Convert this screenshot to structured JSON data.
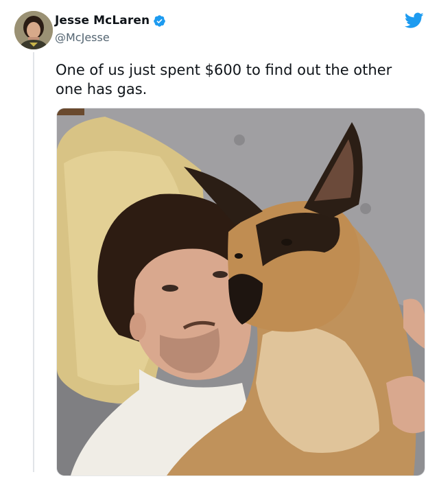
{
  "tweet": {
    "author": {
      "display_name": "Jesse McLaren",
      "handle": "@McJesse",
      "verified": true,
      "verified_icon": "verified-badge-icon",
      "avatar_icon": "avatar"
    },
    "platform_icon": "twitter-bird-icon",
    "text": "One of us just spent $600 to find out the other one has gas.",
    "media": {
      "type": "photo",
      "subject": "man-and-german-shepherd-selfie"
    }
  },
  "colors": {
    "twitter_blue": "#1d9bf0",
    "text_primary": "#0f1419",
    "text_secondary": "#536471"
  }
}
